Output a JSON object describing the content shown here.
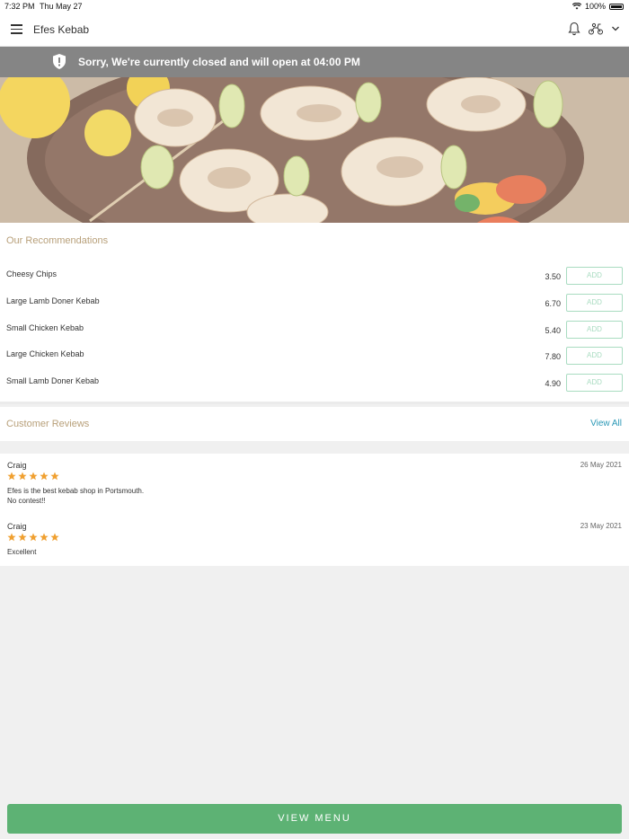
{
  "status_bar": {
    "time": "7:32 PM",
    "date": "Thu May 27",
    "battery": "100%"
  },
  "header": {
    "title": "Efes Kebab"
  },
  "banner": {
    "message": "Sorry, We're currently closed and will open at 04:00 PM"
  },
  "recommendations": {
    "title": "Our Recommendations",
    "add_label": "ADD",
    "items": [
      {
        "name": "Cheesy Chips",
        "price": "3.50"
      },
      {
        "name": "Large Lamb Doner Kebab",
        "price": "6.70"
      },
      {
        "name": "Small Chicken Kebab",
        "price": "5.40"
      },
      {
        "name": "Large Chicken Kebab",
        "price": "7.80"
      },
      {
        "name": "Small Lamb Doner Kebab",
        "price": "4.90"
      }
    ]
  },
  "reviews": {
    "title": "Customer Reviews",
    "view_all": "View All",
    "items": [
      {
        "name": "Craig",
        "date": "26 May 2021",
        "rating": 5,
        "text": "Efes is the best kebab shop in Portsmouth.\nNo contest!!"
      },
      {
        "name": "Craig",
        "date": "23 May 2021",
        "rating": 5,
        "text": "Excellent"
      }
    ]
  },
  "footer": {
    "view_menu": "VIEW MENU"
  },
  "colors": {
    "accent_green": "#5db274",
    "banner_gray": "#858585",
    "section_title": "#b8a07a",
    "link_blue": "#2a98b6",
    "star_orange": "#f0a030"
  },
  "icons": [
    "hamburger-menu-icon",
    "bell-icon",
    "scooter-icon",
    "chevron-down-icon",
    "shield-alert-icon",
    "star-icon",
    "wifi-icon",
    "battery-icon"
  ]
}
